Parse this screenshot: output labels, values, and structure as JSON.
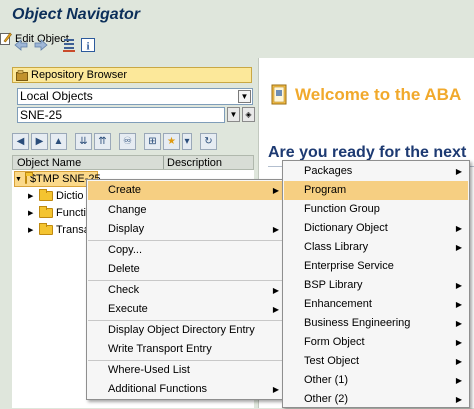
{
  "window": {
    "title": "Object Navigator"
  },
  "toolbar": {
    "back_icon": "back-arrow-icon",
    "forward_icon": "forward-arrow-icon",
    "hierarchy_icon": "hierarchy-icon",
    "info_icon": "info-icon",
    "edit_label": "Edit Object"
  },
  "left": {
    "repository_label": "Repository Browser",
    "object_list_value": "Local Objects",
    "object_name_value": "SNE-25",
    "columns": {
      "name": "Object Name",
      "description": "Description"
    },
    "tree": [
      {
        "label": "$TMP SNE-25",
        "selected": true
      },
      {
        "label": "Dictio"
      },
      {
        "label": "Functio"
      },
      {
        "label": "Transa"
      }
    ]
  },
  "right": {
    "welcome": "Welcome to the ABA",
    "question": "Are you ready for the next"
  },
  "context_menu": {
    "items": [
      {
        "label": "Create",
        "submenu": true,
        "highlighted": true
      },
      {
        "label": "Change"
      },
      {
        "label": "Display",
        "submenu": true
      },
      {
        "label": "Copy..."
      },
      {
        "label": "Delete"
      },
      {
        "label": "Check",
        "submenu": true
      },
      {
        "label": "Execute",
        "submenu": true
      },
      {
        "label": "Display Object Directory Entry"
      },
      {
        "label": "Write Transport Entry"
      },
      {
        "label": "Where-Used List"
      },
      {
        "label": "Additional Functions",
        "submenu": true
      }
    ]
  },
  "create_submenu": {
    "items": [
      {
        "label": "Packages",
        "submenu": true
      },
      {
        "label": "Program",
        "highlighted": true
      },
      {
        "label": "Function Group"
      },
      {
        "label": "Dictionary Object",
        "submenu": true
      },
      {
        "label": "Class Library",
        "submenu": true
      },
      {
        "label": "Enterprise Service"
      },
      {
        "label": "BSP Library",
        "submenu": true
      },
      {
        "label": "Enhancement",
        "submenu": true
      },
      {
        "label": "Business Engineering",
        "submenu": true
      },
      {
        "label": "Form Object",
        "submenu": true
      },
      {
        "label": "Test Object",
        "submenu": true
      },
      {
        "label": "Other (1)",
        "submenu": true
      },
      {
        "label": "Other (2)",
        "submenu": true
      }
    ]
  },
  "colors": {
    "highlight": "#f6cf82",
    "welcome": "#f1a92c",
    "title": "#0c2f5a"
  }
}
